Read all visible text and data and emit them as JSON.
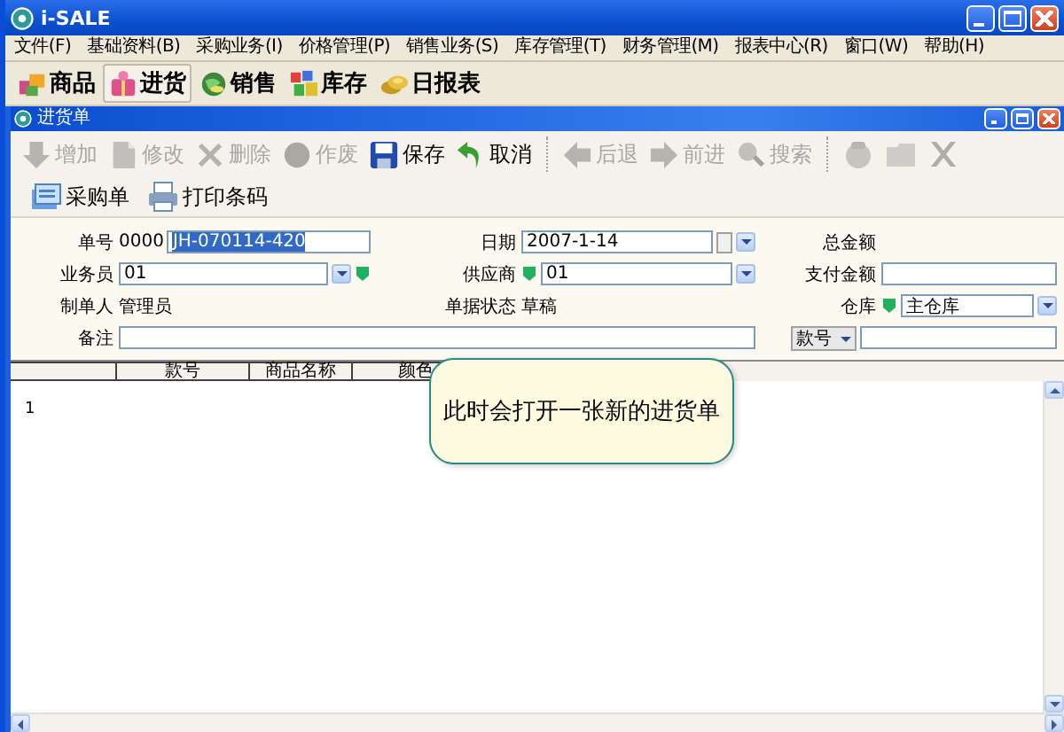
{
  "window": {
    "title": "i-SALE"
  },
  "menu": [
    "文件(F)",
    "基础资料(B)",
    "采购业务(I)",
    "价格管理(P)",
    "销售业务(S)",
    "库存管理(T)",
    "财务管理(M)",
    "报表中心(R)",
    "窗口(W)",
    "帮助(H)"
  ],
  "quick_bar": [
    {
      "label": "商品",
      "selected": false
    },
    {
      "label": "进货",
      "selected": true
    },
    {
      "label": "销售",
      "selected": false
    },
    {
      "label": "库存",
      "selected": false
    },
    {
      "label": "日报表",
      "selected": false
    }
  ],
  "document_window": {
    "title": "进货单"
  },
  "toolbar": [
    {
      "kind": "button",
      "label": "增加",
      "disabled": true
    },
    {
      "kind": "button",
      "label": "修改",
      "disabled": true
    },
    {
      "kind": "button",
      "label": "删除",
      "disabled": true
    },
    {
      "kind": "button",
      "label": "作废",
      "disabled": true
    },
    {
      "kind": "button",
      "label": "保存",
      "disabled": false
    },
    {
      "kind": "button",
      "label": "取消",
      "disabled": false
    },
    {
      "kind": "separator"
    },
    {
      "kind": "button",
      "label": "后退",
      "disabled": true
    },
    {
      "kind": "button",
      "label": "前进",
      "disabled": true
    },
    {
      "kind": "button",
      "label": "搜索",
      "disabled": true
    },
    {
      "kind": "separator"
    },
    {
      "kind": "icon",
      "disabled": true
    },
    {
      "kind": "icon",
      "disabled": true
    },
    {
      "kind": "icon",
      "disabled": true
    }
  ],
  "action_bar": [
    "采购单",
    "打印条码"
  ],
  "form": {
    "doc_no": {
      "label": "单号",
      "prefix": "0000",
      "value": "JH-070114-420",
      "selected": true
    },
    "date": {
      "label": "日期",
      "value": "2007-1-14"
    },
    "total": {
      "label": "总金额"
    },
    "salesperson": {
      "label": "业务员",
      "value": "01"
    },
    "supplier": {
      "label": "供应商",
      "value": "01"
    },
    "payment": {
      "label": "支付金额"
    },
    "creator": {
      "label": "制单人",
      "value": "管理员"
    },
    "status": {
      "label": "单据状态",
      "value": "草稿"
    },
    "warehouse": {
      "label": "仓库",
      "value": "主仓库"
    },
    "note": {
      "label": "备注"
    },
    "filter": {
      "selector": "款号"
    }
  },
  "grid": {
    "columns": [
      "款号",
      "商品名称",
      "颜色"
    ],
    "rows": [
      {
        "number": "1"
      }
    ]
  },
  "callout": {
    "text": "此时会打开一张新的进货单"
  }
}
